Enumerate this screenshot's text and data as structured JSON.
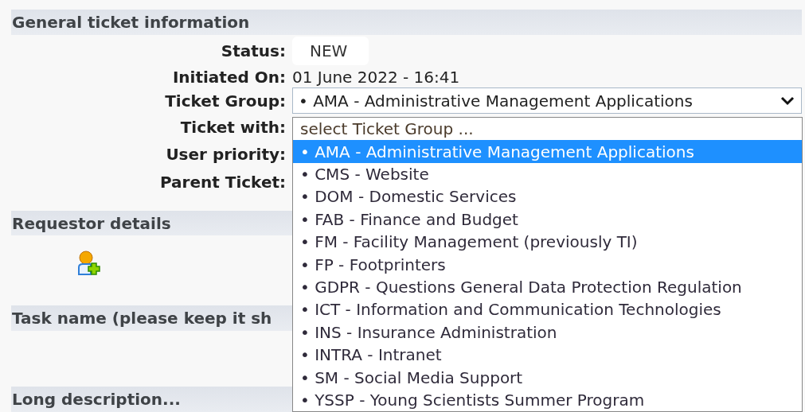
{
  "sections": [
    {
      "title": "General ticket information",
      "kind": "form"
    },
    {
      "title": "Requestor details",
      "kind": "requestor"
    },
    {
      "title": "Task name (please keep it sh",
      "kind": "blank"
    },
    {
      "title": "Long description...",
      "kind": "end"
    }
  ],
  "fields": [
    {
      "label": "Status:",
      "kind": "badge",
      "value": "NEW"
    },
    {
      "label": "Initiated On:",
      "kind": "text",
      "value": "01 June 2022 - 16:41"
    },
    {
      "label": "Ticket Group:",
      "kind": "select",
      "value": "• AMA - Administrative Management Applications"
    },
    {
      "label": "Ticket with:",
      "kind": "empty"
    },
    {
      "label": "User priority:",
      "kind": "empty"
    },
    {
      "label": "Parent Ticket:",
      "kind": "empty"
    }
  ],
  "dropdown": {
    "options": [
      {
        "label": "select Ticket Group ...",
        "kind": "placeholder",
        "selected": false
      },
      {
        "label": "• AMA - Administrative Management Applications",
        "kind": "option",
        "selected": true
      },
      {
        "label": "• CMS - Website",
        "kind": "option",
        "selected": false
      },
      {
        "label": "• DOM - Domestic Services",
        "kind": "option",
        "selected": false
      },
      {
        "label": "• FAB - Finance and Budget",
        "kind": "option",
        "selected": false
      },
      {
        "label": "• FM - Facility Management (previously TI)",
        "kind": "option",
        "selected": false
      },
      {
        "label": "• FP - Footprinters",
        "kind": "option",
        "selected": false
      },
      {
        "label": "• GDPR - Questions General Data Protection Regulation",
        "kind": "option",
        "selected": false
      },
      {
        "label": "• ICT - Information and Communication Technologies",
        "kind": "option",
        "selected": false
      },
      {
        "label": "• INS - Insurance Administration",
        "kind": "option",
        "selected": false
      },
      {
        "label": "• INTRA - Intranet",
        "kind": "option",
        "selected": false
      },
      {
        "label": "• SM - Social Media Support",
        "kind": "option",
        "selected": false
      },
      {
        "label": "• YSSP - Young Scientists Summer Program",
        "kind": "option",
        "selected": false
      }
    ]
  }
}
